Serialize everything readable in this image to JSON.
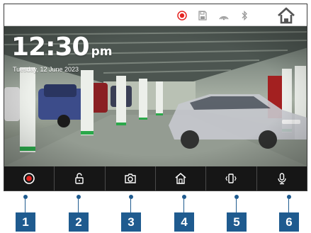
{
  "status_bar": {
    "icons": [
      "record-indicator-icon",
      "save-icon",
      "signal-icon",
      "bluetooth-icon"
    ],
    "home_icon": "home-icon"
  },
  "overlay": {
    "time": "12:30",
    "ampm": "pm",
    "date": "Tuesday, 12 June 2023"
  },
  "toolbar": {
    "buttons": [
      {
        "icon": "record-icon"
      },
      {
        "icon": "unlock-icon"
      },
      {
        "icon": "camera-icon"
      },
      {
        "icon": "house-icon"
      },
      {
        "icon": "vibrate-icon"
      },
      {
        "icon": "microphone-icon"
      }
    ]
  },
  "callouts": [
    "1",
    "2",
    "3",
    "4",
    "5",
    "6"
  ],
  "colors": {
    "record_red": "#e52521",
    "callout_blue": "#1f5b8f",
    "toolbar_bg": "#161616"
  }
}
